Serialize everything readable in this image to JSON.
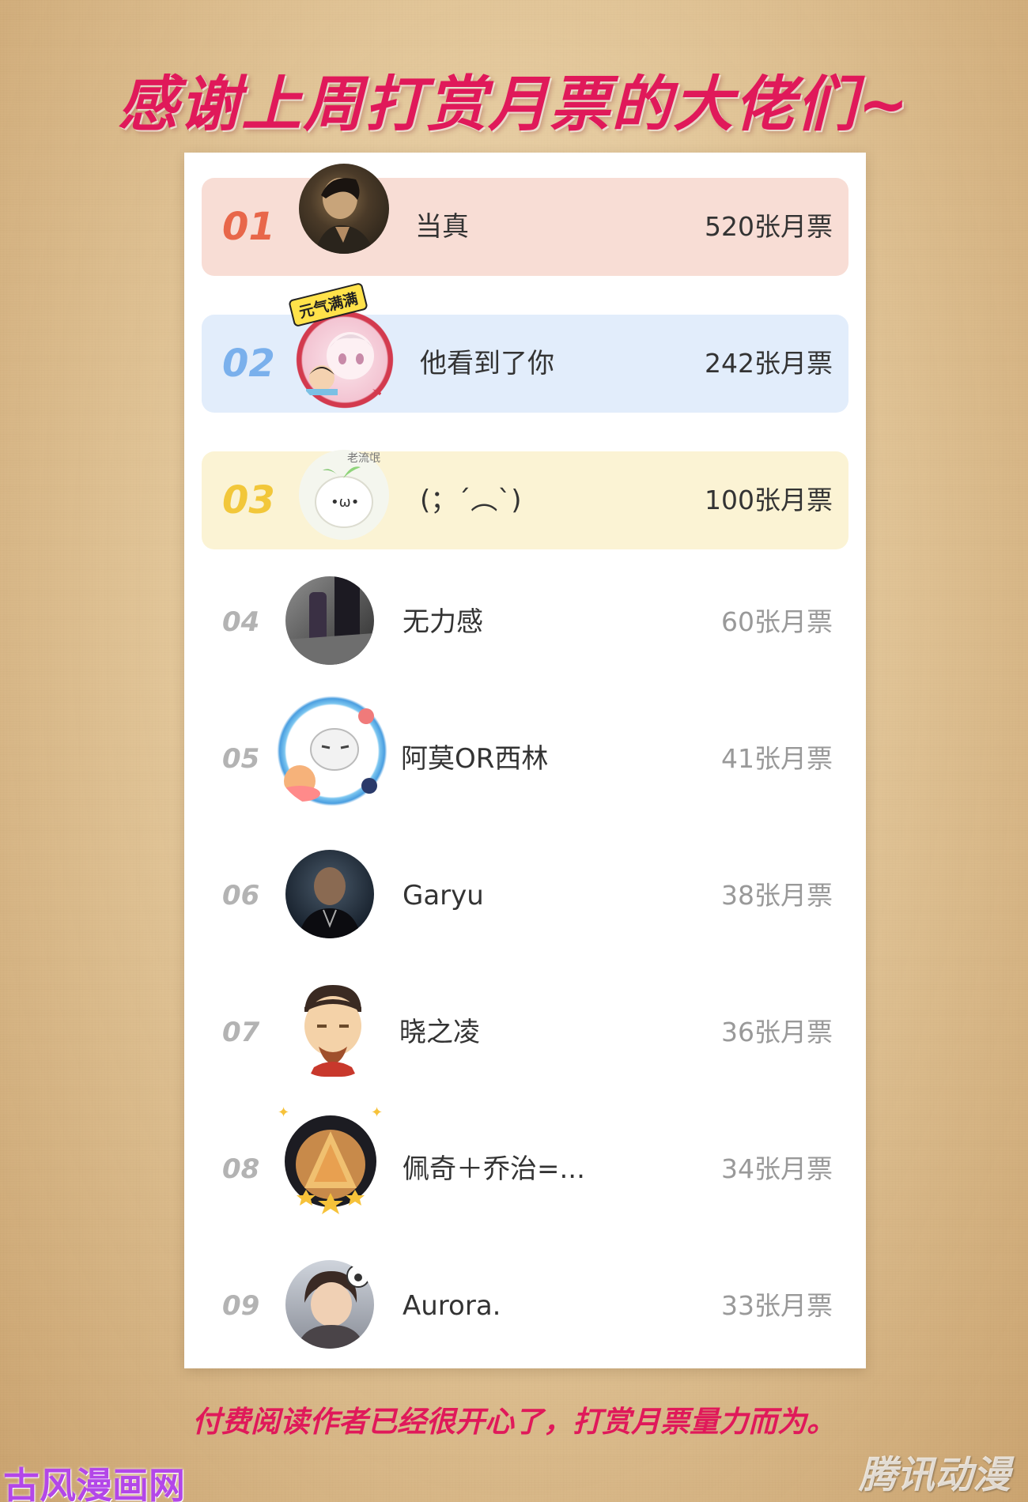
{
  "title": "感谢上周打赏月票的大佬们~",
  "footer": "付费阅读作者已经很开心了，打赏月票量力而为。",
  "watermarks": {
    "left": "古风漫画网",
    "right": "腾讯动漫"
  },
  "colors": {
    "accent": "#e0195a",
    "rank1": "#e8674a",
    "rank1_bg": "#f8ddd5",
    "rank2": "#7ab0ec",
    "rank2_bg": "#e2edfb",
    "rank3": "#f2c73a",
    "rank3_bg": "#fbf3d4"
  },
  "ranking": [
    {
      "rank": "01",
      "name": "当真",
      "tickets": "520张月票"
    },
    {
      "rank": "02",
      "name": "他看到了你",
      "tickets": "242张月票",
      "badge": "元气满满"
    },
    {
      "rank": "03",
      "name": "(；´︵`)",
      "tickets": "100张月票",
      "badge": "老流氓"
    },
    {
      "rank": "04",
      "name": "无力感",
      "tickets": "60张月票"
    },
    {
      "rank": "05",
      "name": "阿莫OR西林",
      "tickets": "41张月票"
    },
    {
      "rank": "06",
      "name": "Garyu",
      "tickets": "38张月票"
    },
    {
      "rank": "07",
      "name": "晓之凌",
      "tickets": "36张月票"
    },
    {
      "rank": "08",
      "name": "佩奇＋乔治=...",
      "tickets": "34张月票"
    },
    {
      "rank": "09",
      "name": "Aurora.",
      "tickets": "33张月票"
    }
  ]
}
